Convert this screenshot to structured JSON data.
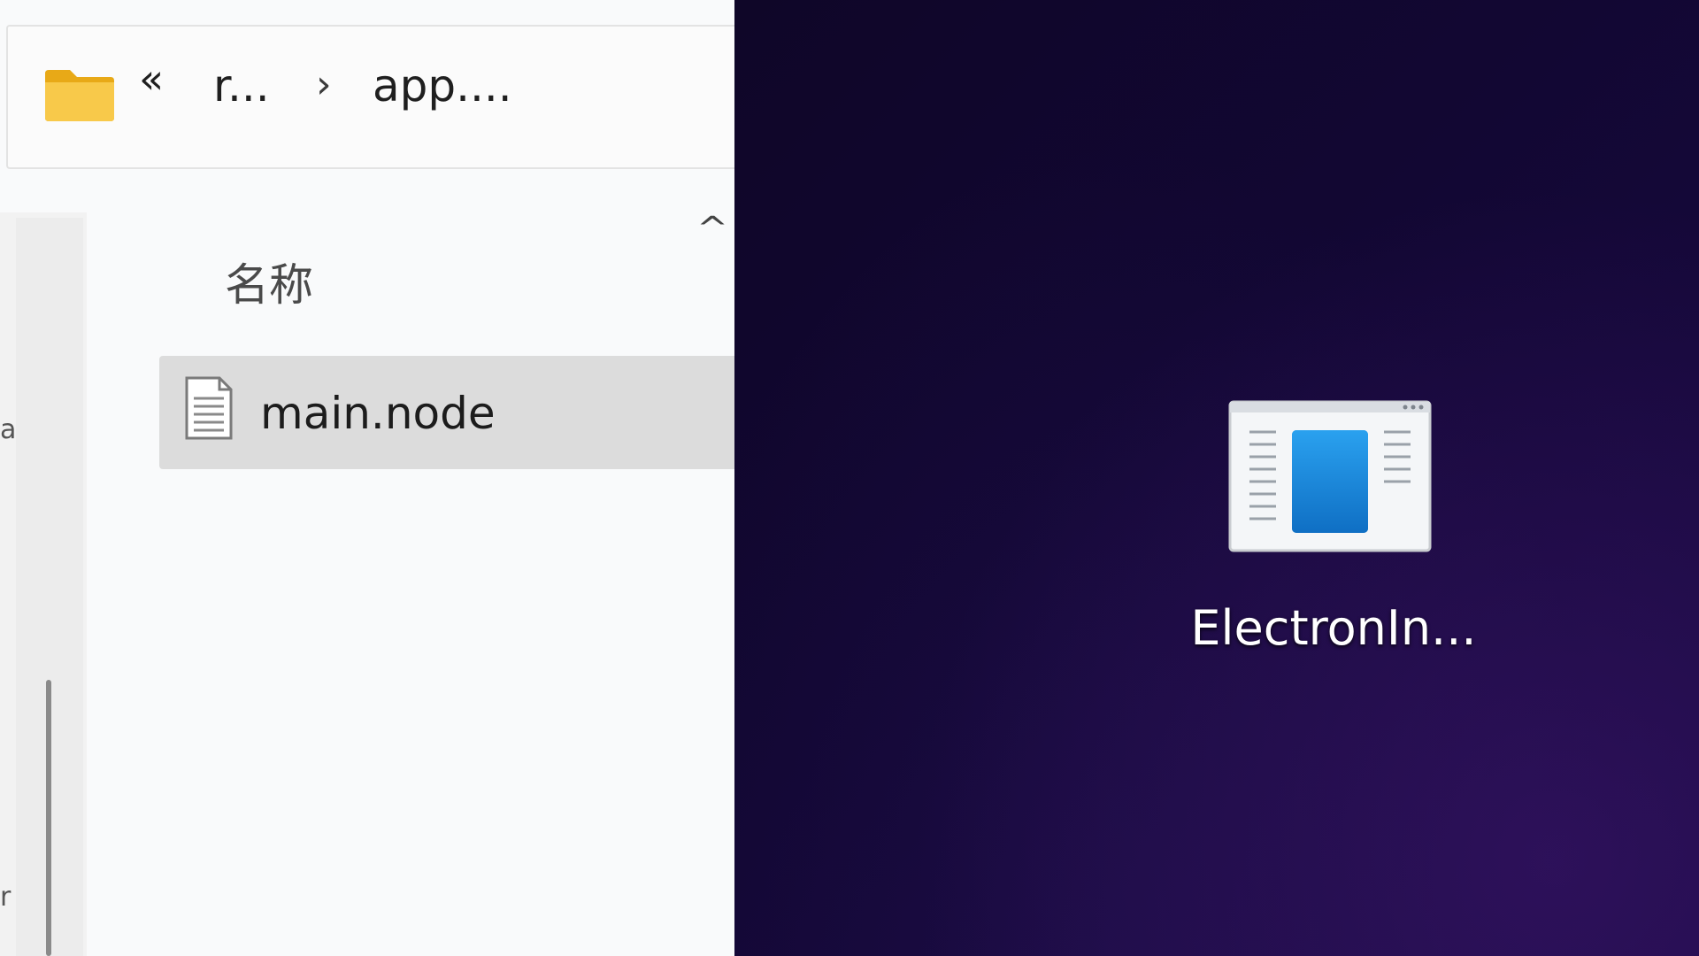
{
  "explorer": {
    "address_bar": {
      "overflow_chevron": "«",
      "crumbs": [
        "r...",
        "app...."
      ],
      "separator": "›"
    },
    "column_header": {
      "name_label": "名称"
    },
    "files": [
      {
        "name": "main.node"
      }
    ]
  },
  "desktop": {
    "icons": [
      {
        "label": "ElectronIn..."
      }
    ]
  },
  "colors": {
    "desktop_background": "#120733",
    "app_icon_accent": "#1a8fe0",
    "folder_yellow": "#f7c948"
  }
}
